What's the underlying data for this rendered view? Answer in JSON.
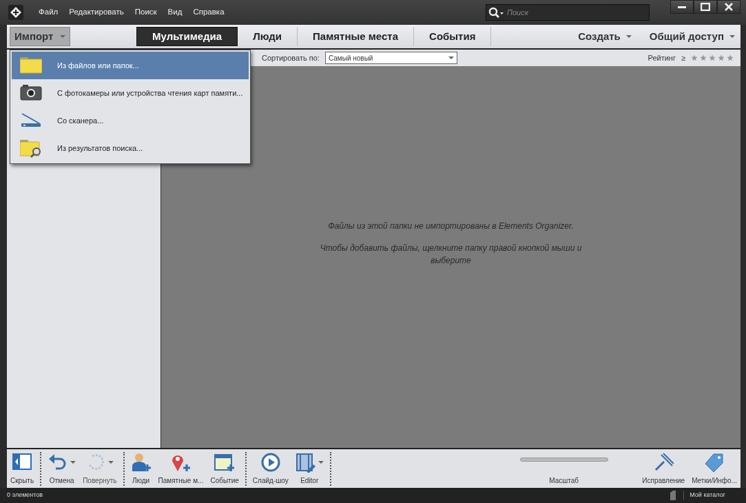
{
  "menu": [
    "Файл",
    "Редактировать",
    "Поиск",
    "Вид",
    "Справка"
  ],
  "search": {
    "placeholder": "Поиск"
  },
  "nav": {
    "import": "Импорт",
    "tabs": [
      {
        "label": "Мультимедиа",
        "selected": true
      },
      {
        "label": "Люди",
        "selected": false
      },
      {
        "label": "Памятные места",
        "selected": false
      },
      {
        "label": "События",
        "selected": false
      }
    ],
    "actions": [
      "Создать",
      "Общий доступ"
    ]
  },
  "import_menu": [
    {
      "label": "Из файлов или папок...",
      "kind": "folder",
      "selected": true
    },
    {
      "label": "С фотокамеры или устройства чтения карт памяти...",
      "kind": "camera",
      "selected": false
    },
    {
      "label": "Со сканера...",
      "kind": "scanner",
      "selected": false
    },
    {
      "label": "Из результатов поиска...",
      "kind": "search-folder",
      "selected": false
    }
  ],
  "sort": {
    "label": "Сортировать по:",
    "value": "Самый новый"
  },
  "rating": {
    "label": "Рейтинг",
    "operator": "≥",
    "stars": 0
  },
  "message": [
    "Файлы из этой папки не импортированы в Elements Organizer.",
    "Чтобы добавить файлы, щелкните папку правой кнопкой мыши и выберите"
  ],
  "toolbar": [
    [
      {
        "label": "Скрыть",
        "kind": "hide",
        "dropdown": false,
        "disabled": false
      }
    ],
    [
      {
        "label": "Отмена",
        "kind": "undo",
        "dropdown": true,
        "disabled": false
      },
      {
        "label": "Повернуть",
        "kind": "rotate",
        "dropdown": true,
        "disabled": true
      }
    ],
    [
      {
        "label": "Люди",
        "kind": "people",
        "dropdown": false,
        "disabled": false
      },
      {
        "label": "Памятные м...",
        "kind": "place",
        "dropdown": false,
        "disabled": false
      },
      {
        "label": "Событие",
        "kind": "event",
        "dropdown": false,
        "disabled": false
      }
    ],
    [
      {
        "label": "Слайд-шоу",
        "kind": "play",
        "dropdown": false,
        "disabled": false
      },
      {
        "label": "Editor",
        "kind": "editor",
        "dropdown": true,
        "disabled": false
      }
    ]
  ],
  "zoom": {
    "label": "Масштаб",
    "disabled": true
  },
  "right_tools": [
    {
      "label": "Исправление",
      "kind": "fix"
    },
    {
      "label": "Метки/Инфо...",
      "kind": "tags"
    }
  ],
  "status": {
    "count": "0 элементов",
    "catalog": "Мой каталог"
  }
}
